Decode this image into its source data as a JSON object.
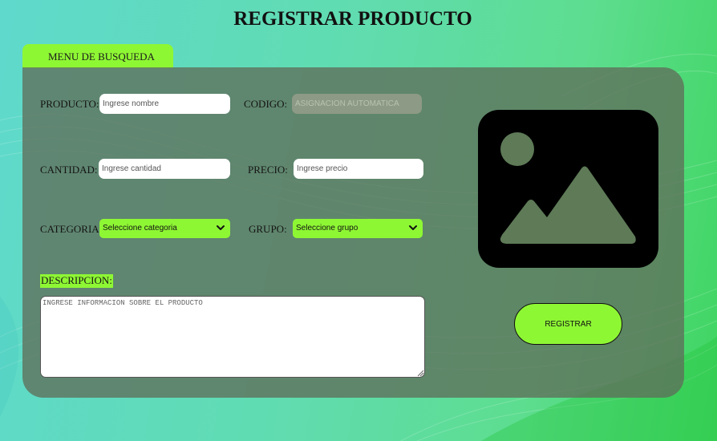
{
  "page": {
    "title": "REGISTRAR PRODUCTO"
  },
  "menu_tab": {
    "label": "MENU DE BUSQUEDA"
  },
  "form": {
    "producto": {
      "label": "PRODUCTO:",
      "placeholder": "Ingrese nombre",
      "value": ""
    },
    "codigo": {
      "label": "CODIGO:",
      "placeholder": "ASIGNACION AUTOMATICA",
      "value": ""
    },
    "cantidad": {
      "label": "CANTIDAD:",
      "placeholder": "Ingrese cantidad",
      "value": ""
    },
    "precio": {
      "label": "PRECIO:",
      "placeholder": "Ingrese precio",
      "value": ""
    },
    "categoria": {
      "label": "CATEGORIA:",
      "selected": "Seleccione categoria"
    },
    "grupo": {
      "label": "GRUPO:",
      "selected": "Seleccione grupo"
    },
    "descripcion": {
      "label": "DESCRIPCION:",
      "placeholder": "INGRESE INFORMACION SOBRE EL PRODUCTO",
      "value": ""
    }
  },
  "image_placeholder": {
    "icon": "image-icon"
  },
  "actions": {
    "register_label": "REGISTRAR"
  },
  "colors": {
    "accent": "#8ef734",
    "panel": "#5f6e5a",
    "image_bg": "#000000"
  }
}
